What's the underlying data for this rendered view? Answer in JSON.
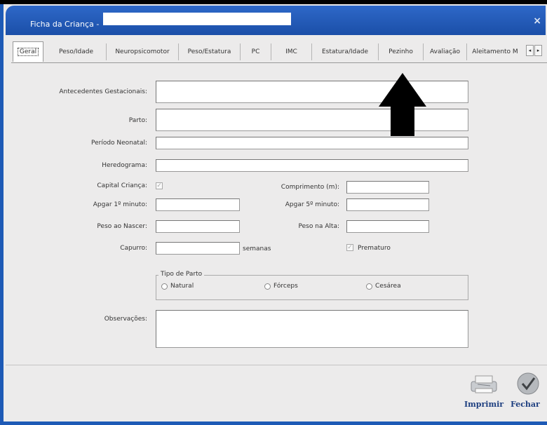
{
  "window": {
    "title": "Ficha da Criança -",
    "title_value": ""
  },
  "tabs": [
    {
      "label": "Geral",
      "active": true
    },
    {
      "label": "Peso/Idade"
    },
    {
      "label": "Neuropsicomotor"
    },
    {
      "label": "Peso/Estatura"
    },
    {
      "label": "PC"
    },
    {
      "label": "IMC"
    },
    {
      "label": "Estatura/Idade"
    },
    {
      "label": "Pezinho"
    },
    {
      "label": "Avaliação"
    },
    {
      "label": "Aleitamento M"
    }
  ],
  "tab_nav": {
    "prev": "◂",
    "next": "▸"
  },
  "form": {
    "antecedentes": {
      "label": "Antecedentes Gestacionais:",
      "value": ""
    },
    "parto": {
      "label": "Parto:",
      "value": ""
    },
    "periodo_neonatal": {
      "label": "Período Neonatal:",
      "value": ""
    },
    "heredograma": {
      "label": "Heredograma:",
      "value": ""
    },
    "capital_crianca": {
      "label": "Capital Criança:",
      "checked": true
    },
    "comprimento": {
      "label": "Comprimento (m):",
      "value": ""
    },
    "apgar1": {
      "label": "Apgar 1º minuto:",
      "value": ""
    },
    "apgar5": {
      "label": "Apgar 5º minuto:",
      "value": ""
    },
    "peso_nascer": {
      "label": "Peso ao Nascer:",
      "value": ""
    },
    "peso_alta": {
      "label": "Peso na Alta:",
      "value": ""
    },
    "capurro": {
      "label": "Capurro:",
      "value": "",
      "unit": "semanas"
    },
    "prematuro": {
      "label": "Prematuro",
      "checked": true
    },
    "tipo_parto": {
      "title": "Tipo de Parto",
      "options": [
        "Natural",
        "Fórceps",
        "Cesárea"
      ]
    },
    "observacoes": {
      "label": "Observações:",
      "value": ""
    }
  },
  "footer": {
    "print_label": "Imprimir",
    "close_label": "Fechar"
  },
  "colors": {
    "titlebar": "#1e5ab6",
    "background": "#ecebeb",
    "button_text": "#1e3f80"
  }
}
